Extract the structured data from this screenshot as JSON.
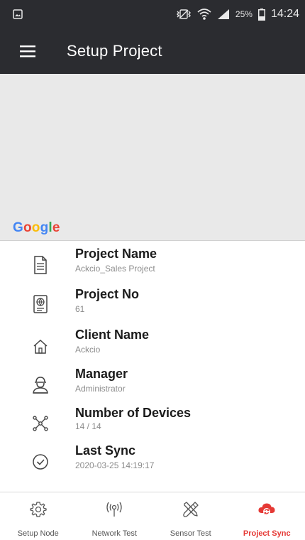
{
  "status_bar": {
    "battery_percent": "25%",
    "time": "14:24"
  },
  "app_bar": {
    "title": "Setup Project",
    "menu_icon": "menu-icon"
  },
  "map": {
    "attribution": [
      "G",
      "o",
      "o",
      "g",
      "l",
      "e"
    ],
    "attribution_colors": [
      "#4285F4",
      "#EA4335",
      "#FBBC05",
      "#4285F4",
      "#34A853",
      "#EA4335"
    ]
  },
  "project_info": [
    {
      "icon": "document-icon",
      "title": "Project Name",
      "value": "Ackcio_Sales Project"
    },
    {
      "icon": "project-no-icon",
      "title": "Project No",
      "value": "61"
    },
    {
      "icon": "home-icon",
      "title": "Client Name",
      "value": "Ackcio"
    },
    {
      "icon": "manager-icon",
      "title": "Manager",
      "value": "Administrator"
    },
    {
      "icon": "network-icon",
      "title": "Number of Devices",
      "value": "14 / 14"
    },
    {
      "icon": "check-circle-icon",
      "title": "Last Sync",
      "value": "2020-03-25 14:19:17"
    }
  ],
  "bottom_nav": {
    "active_color": "#e53935",
    "items": [
      {
        "icon": "gear-icon",
        "label": "Setup Node",
        "active": false
      },
      {
        "icon": "antenna-icon",
        "label": "Network Test",
        "active": false
      },
      {
        "icon": "tools-icon",
        "label": "Sensor Test",
        "active": false
      },
      {
        "icon": "cloud-sync-icon",
        "label": "Project Sync",
        "active": true
      }
    ]
  }
}
